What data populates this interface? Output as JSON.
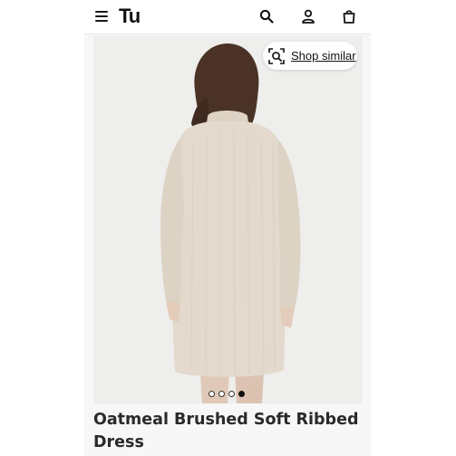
{
  "header": {
    "logo": "Tu",
    "icons": [
      "hamburger-menu-icon",
      "search-icon",
      "account-icon",
      "basket-icon"
    ]
  },
  "gallery": {
    "shop_similar_label": "Shop similar",
    "image_count": 4,
    "active_image_index": 4
  },
  "product": {
    "title": "Oatmeal Brushed Soft Ribbed Dress"
  },
  "colors": {
    "dress": "#e3d9cc",
    "hair": "#4a3326",
    "background": "#eeeeec"
  }
}
